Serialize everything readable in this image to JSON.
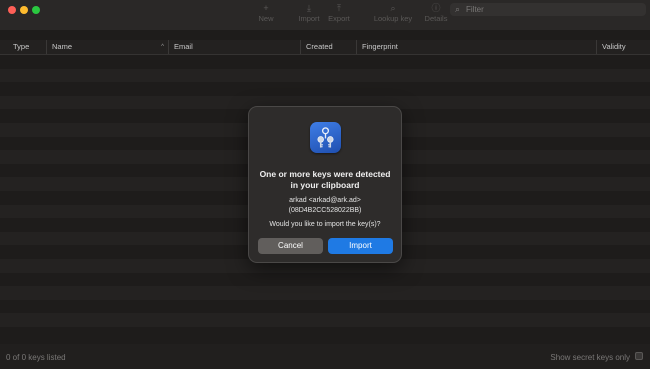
{
  "toolbar": {
    "items": [
      {
        "label": "New",
        "icon": "plus-icon"
      },
      {
        "label": "Import",
        "icon": "import-icon"
      },
      {
        "label": "Export",
        "icon": "export-icon"
      },
      {
        "label": "Lookup key",
        "icon": "lookup-icon"
      },
      {
        "label": "Details",
        "icon": "info-icon"
      }
    ],
    "search_placeholder": "Filter"
  },
  "table": {
    "columns": [
      "Type",
      "Name",
      "Email",
      "Created",
      "Fingerprint",
      "Validity"
    ]
  },
  "status": {
    "keys_listed": "0 of 0 keys listed",
    "show_secret_label": "Show secret keys only"
  },
  "dialog": {
    "title_line1": "One or more keys were detected",
    "title_line2": "in your clipboard",
    "key_name": "arkad <arkad@ark.ad>",
    "key_id": "(08D4B2CC528022BB)",
    "question": "Would you like to import the key(s)?",
    "cancel_label": "Cancel",
    "import_label": "Import"
  },
  "colors": {
    "accent": "#1f7ae4",
    "close": "#fe5f57",
    "minimize": "#febb2e",
    "maximize": "#2ac840"
  }
}
